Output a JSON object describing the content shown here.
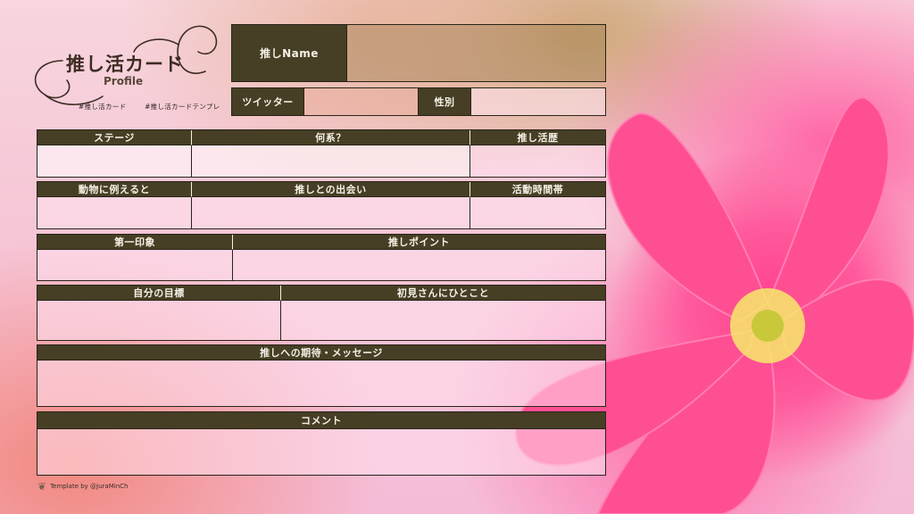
{
  "logo": {
    "title": "推し活カード",
    "subtitle": "Profile"
  },
  "hashtags": [
    "#推し活カード",
    "#推し活カードテンプレ"
  ],
  "name_row": {
    "label": "推しName"
  },
  "twitter_row": {
    "twitter_label": "ツイッター",
    "gender_label": "性別"
  },
  "row1": [
    "ステージ",
    "何系？",
    "推し活歴"
  ],
  "row2": [
    "動物に例えると",
    "推しとの出会い",
    "活動時間帯"
  ],
  "row3": [
    "第一印象",
    "推しポイント"
  ],
  "row4": [
    "自分の目標",
    "初見さんにひとこと"
  ],
  "row5": [
    "推しへの期待・メッセージ"
  ],
  "row6": [
    "コメント"
  ],
  "credit": "Template by @JuraMinCh",
  "colors": {
    "header_bg": "#463f25",
    "header_text": "#f5f1e6",
    "border": "#2a2418"
  }
}
